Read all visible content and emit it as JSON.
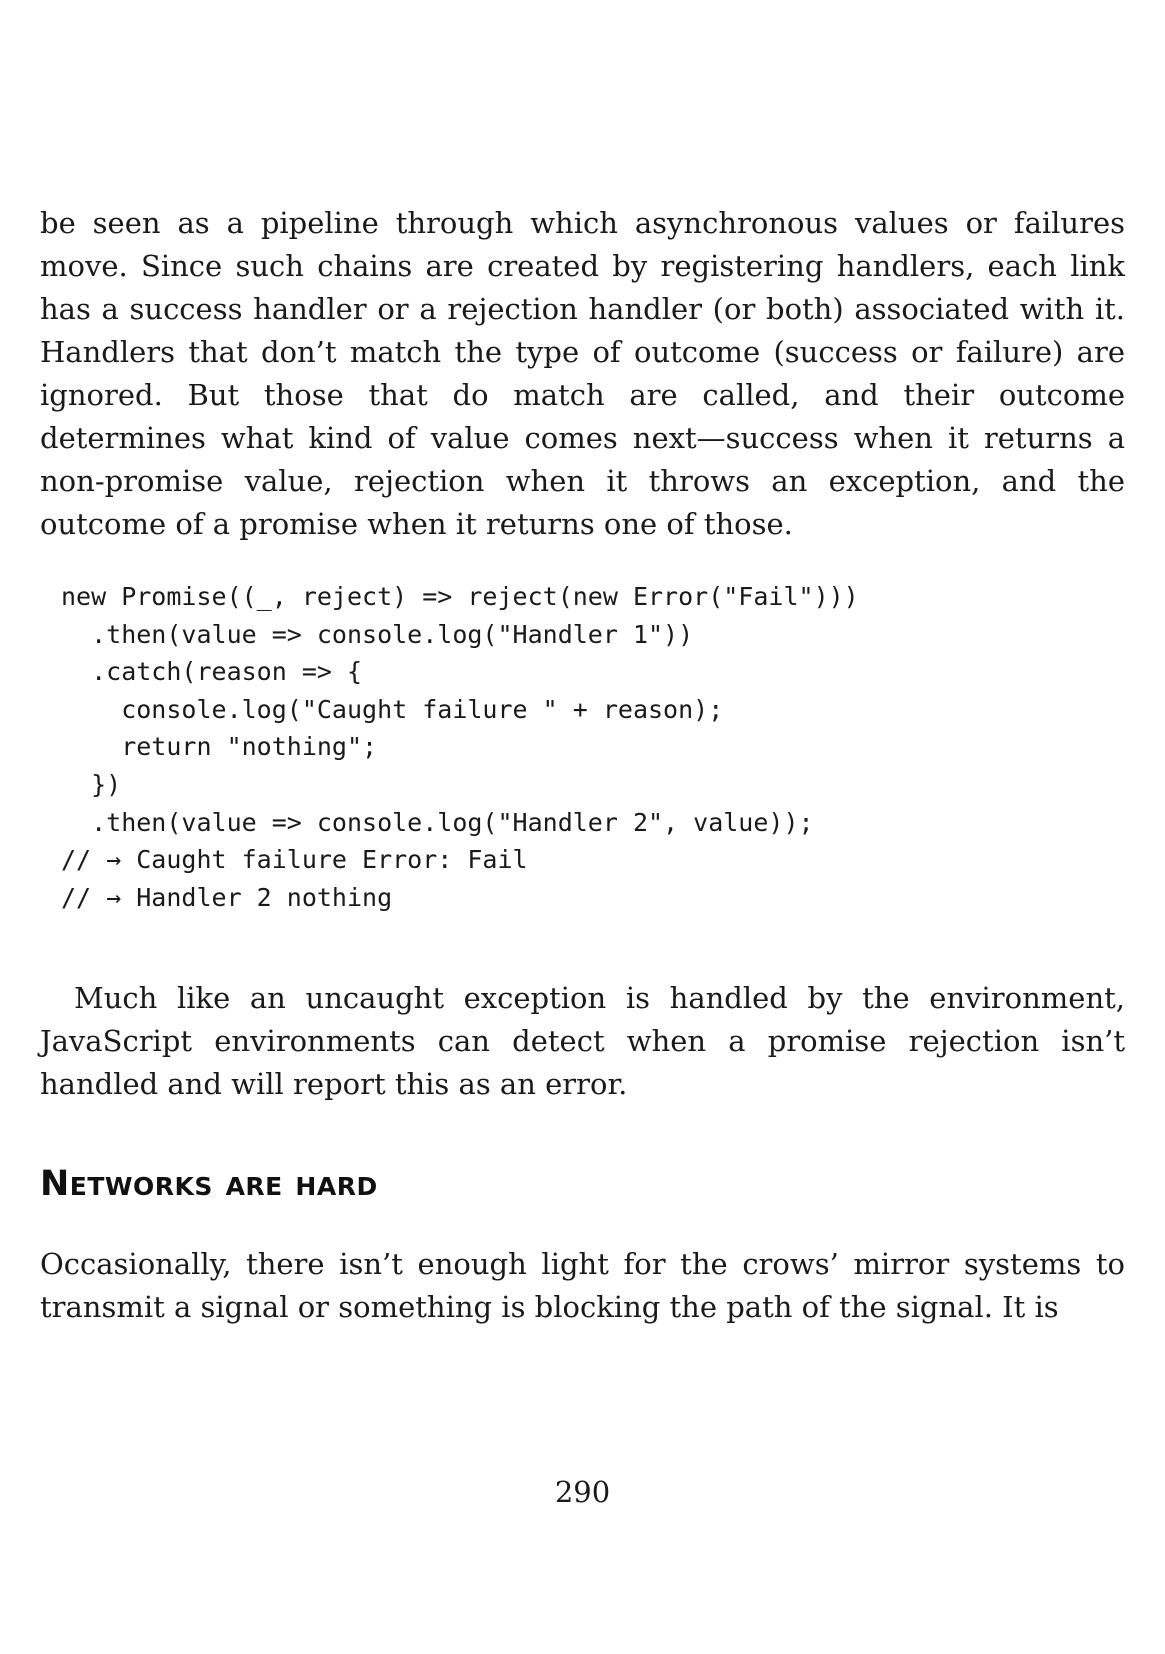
{
  "paragraphs": {
    "p1": "be seen as a pipeline through which asynchronous values or failures move. Since such chains are created by registering handlers, each link has a success handler or a rejection handler (or both) associated with it. Handlers that don’t match the type of outcome (success or failure) are ignored. But those that do match are called, and their outcome determines what kind of value comes next—success when it returns a non-promise value, rejection when it throws an exception, and the outcome of a promise when it returns one of those.",
    "p2": "Much like an uncaught exception is handled by the environment, JavaScript environments can detect when a promise rejection isn’t handled and will report this as an error.",
    "p3": "Occasionally, there isn’t enough light for the crows’ mirror systems to transmit a signal or something is blocking the path of the signal. It is"
  },
  "code": {
    "lines": [
      "new Promise((_, reject) => reject(new Error(\"Fail\")))",
      "  .then(value => console.log(\"Handler 1\"))",
      "  .catch(reason => {",
      "    console.log(\"Caught failure \" + reason);",
      "    return \"nothing\";",
      "  })",
      "  .then(value => console.log(\"Handler 2\", value));",
      "// → Caught failure Error: Fail",
      "// → Handler 2 nothing"
    ]
  },
  "heading": {
    "section_title": "Networks are hard"
  },
  "footer": {
    "page_number": "290"
  }
}
